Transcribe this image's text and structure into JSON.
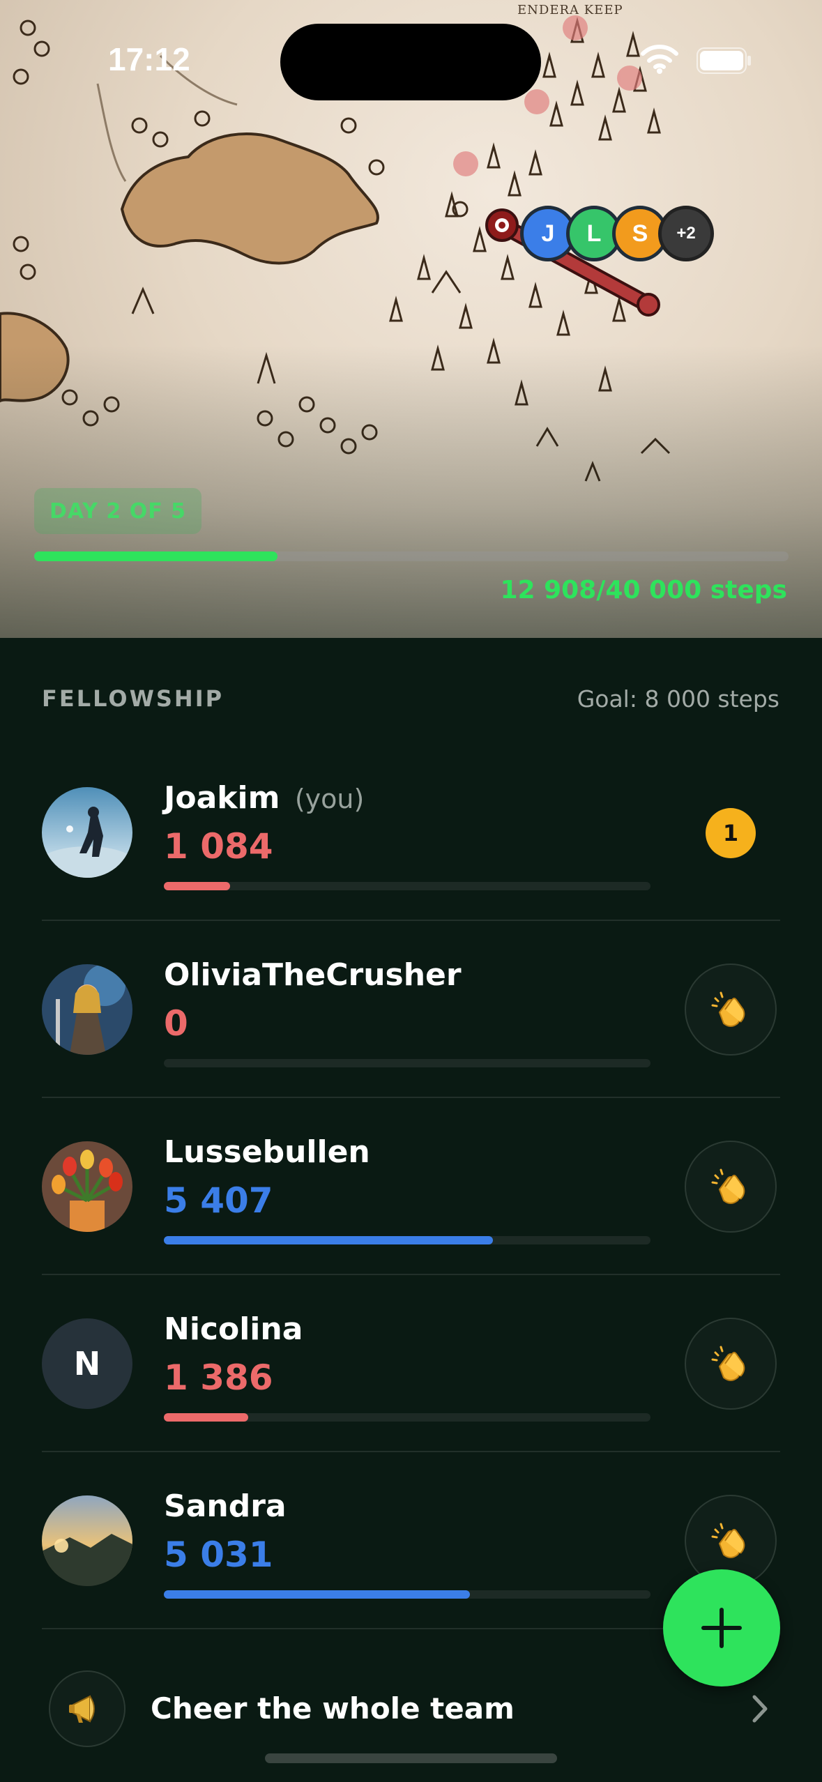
{
  "status": {
    "time": "17:12"
  },
  "map": {
    "place_label": "ENDERA KEEP",
    "avatars": [
      {
        "initial": "J",
        "color": "#3b7ee8"
      },
      {
        "initial": "L",
        "color": "#36c56a"
      },
      {
        "initial": "S",
        "color": "#f29b1d"
      },
      {
        "initial": "+2",
        "color": "#3a3a3a"
      }
    ]
  },
  "trip": {
    "day_label": "DAY 2 OF 5",
    "progress": 0.3227,
    "steps_label": "12 908/40 000 steps"
  },
  "fellowship": {
    "title": "FELLOWSHIP",
    "goal_label": "Goal: 8 000 steps",
    "members": [
      {
        "name": "Joakim",
        "you_label": "(you)",
        "steps": "1 084",
        "progress": 0.1355,
        "color": "#ec6a6a",
        "rank": "1",
        "avatar": "photo-diver"
      },
      {
        "name": "OliviaTheCrusher",
        "steps": "0",
        "progress": 0.0,
        "color": "#ec6a6a",
        "avatar": "photo-warrior"
      },
      {
        "name": "Lussebullen",
        "steps": "5 407",
        "progress": 0.6759,
        "color": "#3b7ee8",
        "avatar": "photo-tulips"
      },
      {
        "name": "Nicolina",
        "steps": "1 386",
        "progress": 0.1733,
        "color": "#ec6a6a",
        "avatar_letter": "N"
      },
      {
        "name": "Sandra",
        "steps": "5 031",
        "progress": 0.6289,
        "color": "#3b7ee8",
        "avatar": "photo-landscape"
      }
    ]
  },
  "cheer_all": {
    "label": "Cheer the whole team"
  },
  "icons": [
    "wifi-icon",
    "battery-icon",
    "clap-icon",
    "add-icon",
    "megaphone-icon",
    "chevron-right-icon",
    "route-start-icon"
  ]
}
